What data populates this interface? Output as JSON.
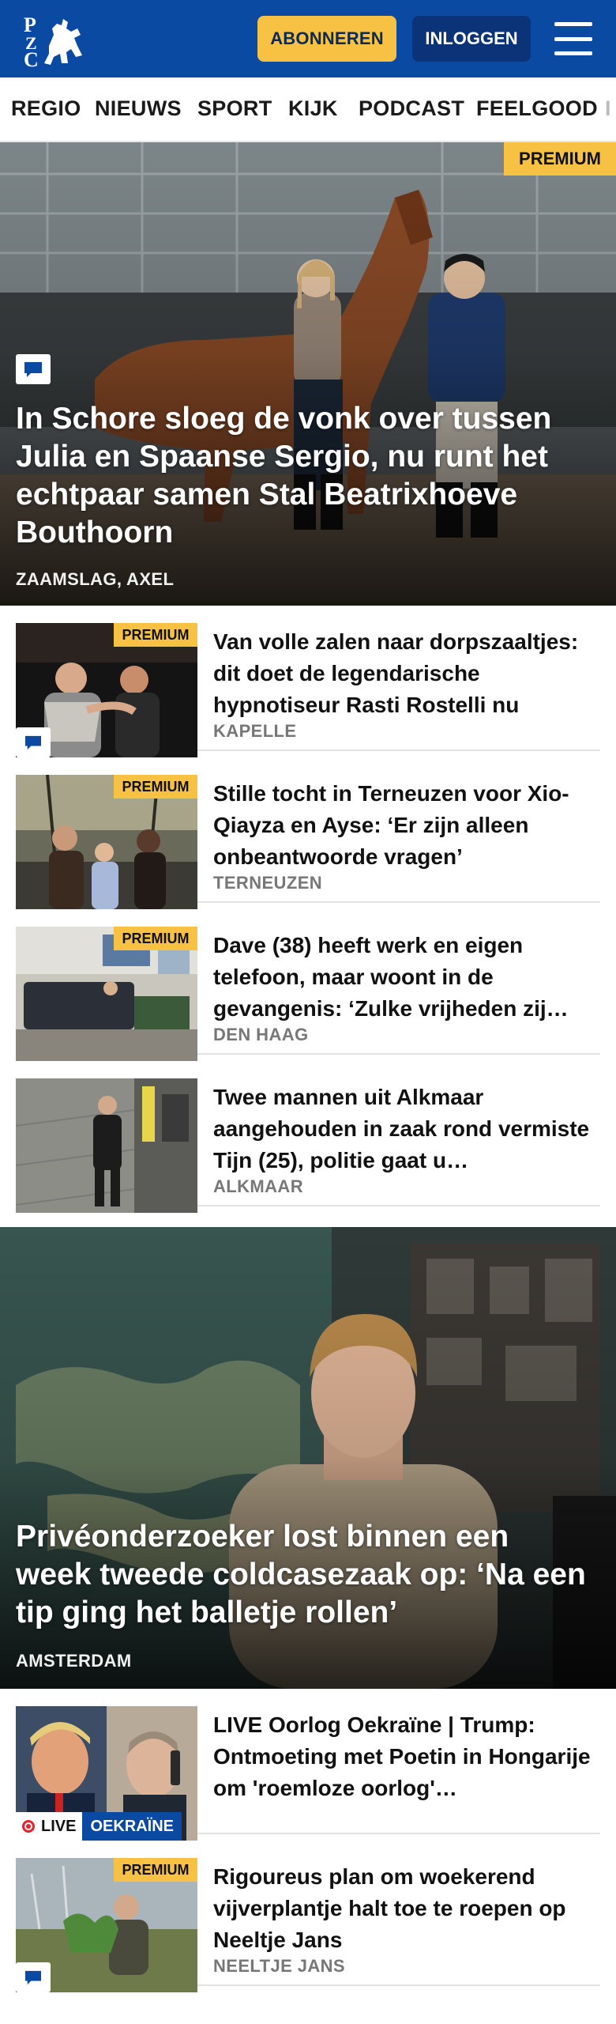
{
  "header": {
    "logo_text": "PZC",
    "subscribe_label": "ABONNEREN",
    "login_label": "INLOGGEN"
  },
  "nav": {
    "items": [
      "REGIO",
      "NIEUWS",
      "SPORT",
      "KIJK",
      "PODCAST",
      "FEELGOOD",
      "I"
    ]
  },
  "hero": {
    "badge": "PREMIUM",
    "title": "In Schore sloeg de vonk over tussen Julia en Spaanse Sergio, nu runt het echtpaar samen Stal Beatrixhoeve Bouthoorn",
    "location": "ZAAMSLAG, AXEL",
    "has_comments": true
  },
  "articles": [
    {
      "badge": "PREMIUM",
      "title": "Van volle zalen naar dorpszaal­tjes: dit doet de legendarische hypnotiseur Rasti Rostelli nu",
      "location": "KAPELLE",
      "has_comments": true
    },
    {
      "badge": "PREMIUM",
      "title": "Stille tocht in Terneuzen voor Xi­o-Qiayza en Ayse: ‘Er zijn alleen onbeantwoorde vragen’",
      "location": "TERNEUZEN"
    },
    {
      "badge": "PREMIUM",
      "title": "Dave (38) heeft werk en eigen telefoon, maar woont in de gevangenis: ‘Zulke vrijheden zij…",
      "location": "DEN HAAG"
    },
    {
      "title": "Twee mannen uit Alkmaar aangehouden in zaak rond vermiste Tijn (25), politie gaat u…",
      "location": "ALKMAAR"
    }
  ],
  "feature": {
    "title": "Privéonderzoeker lost binnen een week tweede coldcasezaak op: ‘Na een tip ging het balletje rollen’",
    "location": "AMSTERDAM"
  },
  "articles2": [
    {
      "title": "LIVE Oorlog Oekraïne | Trump: Ontmoeting met Poetin in Hongarije om 'roemloze oorlog'…",
      "live_label": "LIVE",
      "topic_label": "OEKRAÏNE"
    },
    {
      "badge": "PREMIUM",
      "title": "Rigoureus plan om woekerend vijverplantje halt toe te roepen op Neeltje Jans",
      "location": "NEELTJE JANS",
      "has_comments": true
    }
  ],
  "colors": {
    "brand_blue": "#0b4aa3",
    "accent_yellow": "#f7c244",
    "login_blue": "#0a3477",
    "live_red": "#e3232f"
  }
}
